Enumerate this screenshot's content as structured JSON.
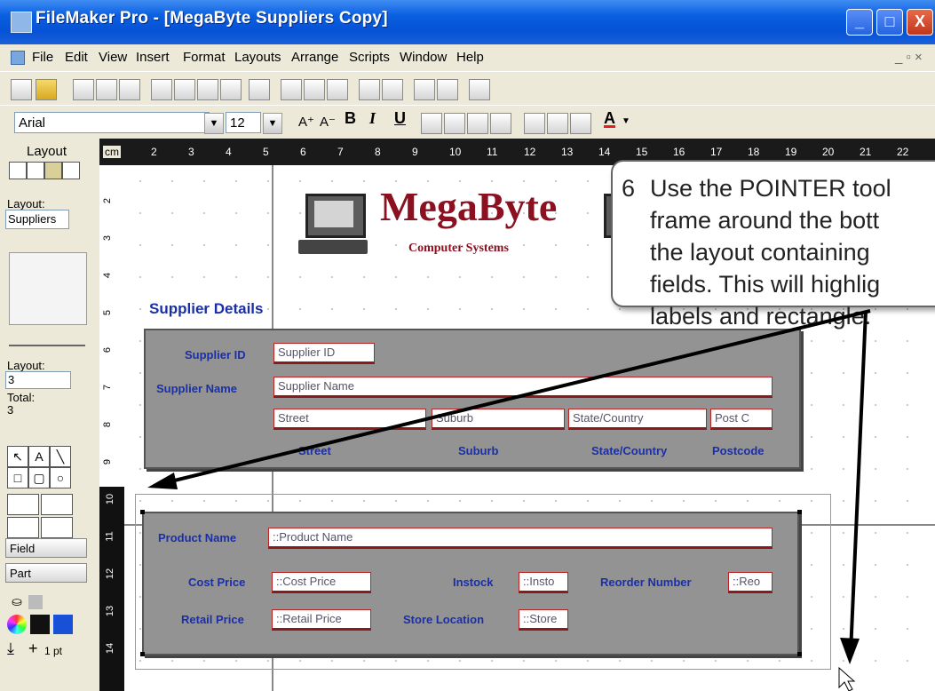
{
  "window": {
    "title": "FileMaker Pro - [MegaByte Suppliers Copy]",
    "minimize": "_",
    "maximize": "□",
    "close": "X",
    "doc_controls": "_ ▫ ×"
  },
  "menu": [
    "File",
    "Edit",
    "View",
    "Insert",
    "Format",
    "Layouts",
    "Arrange",
    "Scripts",
    "Window",
    "Help"
  ],
  "format_bar": {
    "font": "Arial",
    "size": "12",
    "grow_font": "A⁺",
    "shrink_font": "A⁻",
    "bold": "B",
    "italic": "I",
    "underline": "U",
    "text_color": "A"
  },
  "left_panel": {
    "mode": "Layout",
    "layout_label": "Layout:",
    "layout_value": "Suppliers",
    "layout_num_label": "Layout:",
    "layout_num": "3",
    "total_label": "Total:",
    "total": "3",
    "field_button": "Field",
    "part_button": "Part",
    "line_width": "1 pt"
  },
  "ruler": {
    "unit": "cm",
    "h_ticks": [
      "2",
      "3",
      "4",
      "5",
      "6",
      "7",
      "8",
      "9",
      "10",
      "11",
      "12",
      "13",
      "14",
      "15",
      "16",
      "17",
      "18",
      "19",
      "20",
      "21",
      "22"
    ],
    "v_ticks": [
      "2",
      "3",
      "4",
      "5",
      "6",
      "7",
      "8",
      "9",
      "10",
      "11",
      "12",
      "13",
      "14"
    ]
  },
  "header": {
    "logo_title": "MegaByte",
    "logo_subtitle": "Computer Systems",
    "section_title": "Supplier Details"
  },
  "supplier_section": {
    "supplier_id_label": "Supplier ID",
    "supplier_id_field": "Supplier ID",
    "supplier_name_label": "Supplier Name",
    "supplier_name_field": "Supplier Name",
    "street_field": "Street",
    "suburb_field": "Suburb",
    "state_field": "State/Country",
    "postcode_field": "Post C",
    "street_label": "Street",
    "suburb_label": "Suburb",
    "state_label": "State/Country",
    "postcode_label": "Postcode"
  },
  "product_section": {
    "product_name_label": "Product Name",
    "product_name_field": "::Product Name",
    "cost_price_label": "Cost Price",
    "cost_price_field": "::Cost Price",
    "instock_label": "Instock",
    "instock_field": "::Insto",
    "reorder_label": "Reorder Number",
    "reorder_field": "::Reo",
    "retail_price_label": "Retail Price",
    "retail_price_field": "::Retail Price",
    "store_location_label": "Store Location",
    "store_location_field": "::Store"
  },
  "callout": {
    "number": "6",
    "line1": "Use the POINTER tool",
    "line2": "frame around the bott",
    "line3": "the layout containing",
    "line4": "fields.  This will highlig",
    "line5": "labels and rectangle."
  }
}
